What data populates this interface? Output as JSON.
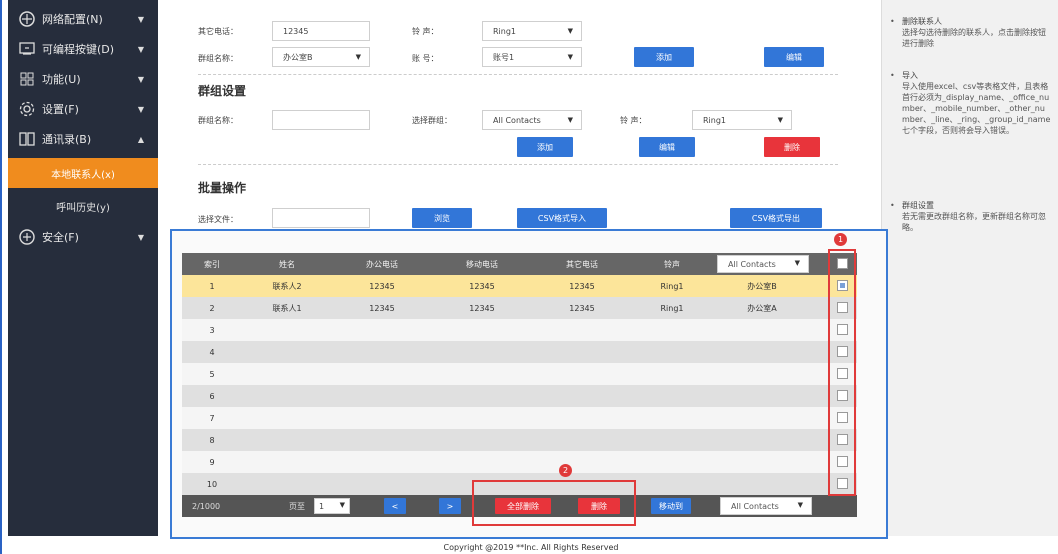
{
  "sidebar": {
    "items": [
      {
        "label": "网络配置(N)",
        "icon": "network-icon",
        "arrow": "▼"
      },
      {
        "label": "可编程按键(D)",
        "icon": "keyboard-icon",
        "arrow": "▼"
      },
      {
        "label": "功能(U)",
        "icon": "grid-icon",
        "arrow": "▼"
      },
      {
        "label": "设置(F)",
        "icon": "gear-icon",
        "arrow": "▼"
      },
      {
        "label": "通讯录(B)",
        "icon": "contacts-book-icon",
        "arrow": "▲"
      },
      {
        "label": "本地联系人(x)",
        "icon": "",
        "arrow": ""
      },
      {
        "label": "呼叫历史(y)",
        "icon": "",
        "arrow": ""
      },
      {
        "label": "安全(F)",
        "icon": "shield-icon",
        "arrow": "▼"
      }
    ]
  },
  "contact_form": {
    "office_phone_label": "其它电话：",
    "office_phone_value": "12345",
    "ring_label": "铃    声：",
    "ring_value": "Ring1",
    "group_name_label": "群组名称：",
    "group_name_value": "办公室B",
    "account_label": "账    号：",
    "account_value": "账号1",
    "add_button": "添加",
    "edit_button": "编辑"
  },
  "group_settings": {
    "title": "群组设置",
    "group_name_label": "群组名称：",
    "group_name_value": "",
    "select_group_label": "选择群组：",
    "select_group_value": "All Contacts",
    "ring_label": "铃    声：",
    "ring_value": "Ring1",
    "add_button": "添加",
    "edit_button": "编辑",
    "delete_button": "删除"
  },
  "batch": {
    "title": "批量操作",
    "file_label": "选择文件：",
    "file_value": "",
    "browse_button": "浏览",
    "import_button": "CSV格式导入",
    "export_button": "CSV格式导出"
  },
  "table": {
    "headers": [
      "索引",
      "姓名",
      "办公电话",
      "移动电话",
      "其它电话",
      "铃声"
    ],
    "group_filter": "All Contacts",
    "rows": [
      {
        "index": "1",
        "name": "联系人2",
        "office": "12345",
        "mobile": "12345",
        "other": "12345",
        "ring": "Ring1",
        "group": "办公室B",
        "checked": true,
        "selected": true
      },
      {
        "index": "2",
        "name": "联系人1",
        "office": "12345",
        "mobile": "12345",
        "other": "12345",
        "ring": "Ring1",
        "group": "办公室A",
        "checked": false,
        "selected": false
      },
      {
        "index": "3",
        "name": "",
        "office": "",
        "mobile": "",
        "other": "",
        "ring": "",
        "group": "",
        "checked": false,
        "selected": false
      },
      {
        "index": "4",
        "name": "",
        "office": "",
        "mobile": "",
        "other": "",
        "ring": "",
        "group": "",
        "checked": false,
        "selected": false
      },
      {
        "index": "5",
        "name": "",
        "office": "",
        "mobile": "",
        "other": "",
        "ring": "",
        "group": "",
        "checked": false,
        "selected": false
      },
      {
        "index": "6",
        "name": "",
        "office": "",
        "mobile": "",
        "other": "",
        "ring": "",
        "group": "",
        "checked": false,
        "selected": false
      },
      {
        "index": "7",
        "name": "",
        "office": "",
        "mobile": "",
        "other": "",
        "ring": "",
        "group": "",
        "checked": false,
        "selected": false
      },
      {
        "index": "8",
        "name": "",
        "office": "",
        "mobile": "",
        "other": "",
        "ring": "",
        "group": "",
        "checked": false,
        "selected": false
      },
      {
        "index": "9",
        "name": "",
        "office": "",
        "mobile": "",
        "other": "",
        "ring": "",
        "group": "",
        "checked": false,
        "selected": false
      },
      {
        "index": "10",
        "name": "",
        "office": "",
        "mobile": "",
        "other": "",
        "ring": "",
        "group": "",
        "checked": false,
        "selected": false
      }
    ],
    "footer": {
      "count": "2/1000",
      "page_label": "页至",
      "page_value": "1",
      "prev_button": "<",
      "next_button": ">",
      "delete_all_button": "全部删除",
      "delete_button": "删除",
      "move_to_button": "移动到",
      "move_target": "All Contacts"
    }
  },
  "annotations": {
    "badge1": "1",
    "badge2": "2",
    "color": "#e03a3a"
  },
  "help": {
    "items": [
      {
        "title": "删除联系人",
        "text": "选择勾选待删除的联系人，点击删除按钮进行删除"
      },
      {
        "title": "导入",
        "text": "导入使用excel、csv等表格文件，且表格首行必须为_display_name、_office_number、_mobile_number、_other_number、_line、_ring、_group_id_name七个字段，否则将会导入错误。"
      },
      {
        "title": "群组设置",
        "text": "若无需更改群组名称，更新群组名称可忽略。"
      }
    ]
  },
  "footer": {
    "copyright": "Copyright @2019 **Inc. All Rights Reserved"
  },
  "colors": {
    "sidebar": "#262d3c",
    "active": "#f08c1e",
    "blue_button": "#3276d8",
    "red_button": "#e8343b",
    "selected_row": "#fce59a"
  }
}
